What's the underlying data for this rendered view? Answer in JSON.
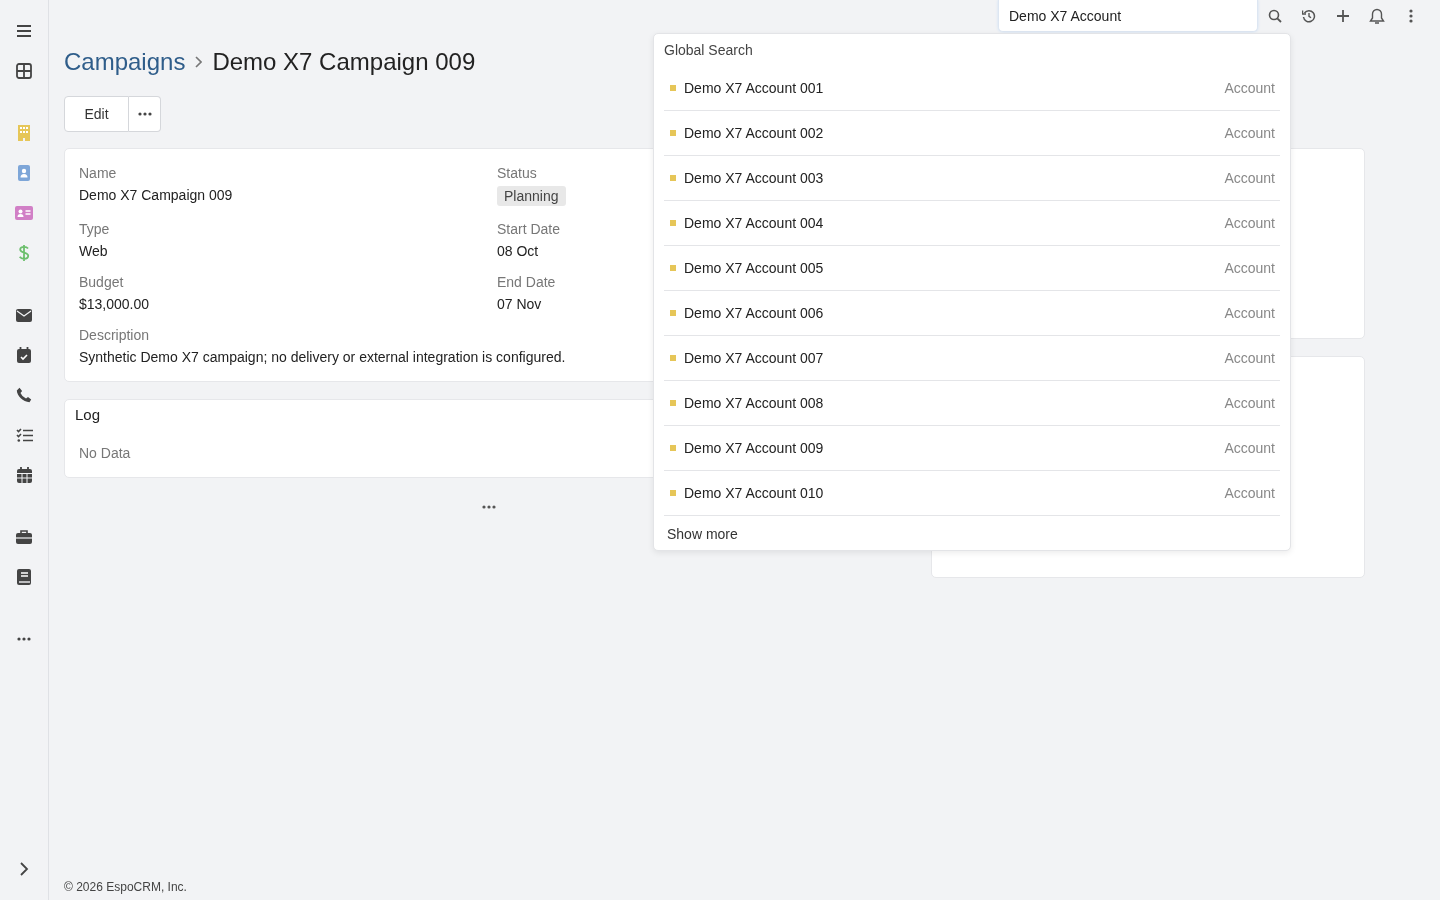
{
  "top_bar": {
    "search": {
      "value": "Demo X7 Account"
    }
  },
  "breadcrumb": {
    "parent": "Campaigns",
    "current": "Demo X7 Campaign 009"
  },
  "actions": {
    "edit": "Edit"
  },
  "fields": [
    {
      "label": "Name",
      "value": "Demo X7 Campaign 009",
      "kind": "text"
    },
    {
      "label": "Status",
      "value": "Planning",
      "kind": "badge"
    },
    {
      "label": "Type",
      "value": "Web",
      "kind": "text"
    },
    {
      "label": "Start Date",
      "value": "08 Oct",
      "kind": "text"
    },
    {
      "label": "Budget",
      "value": "$13,000.00",
      "kind": "text"
    },
    {
      "label": "End Date",
      "value": "07 Nov",
      "kind": "text"
    },
    {
      "label": "Description",
      "value": "Synthetic Demo X7 campaign; no delivery or external integration is configured.",
      "kind": "wide"
    }
  ],
  "log": {
    "title": "Log",
    "empty": "No Data"
  },
  "global_search": {
    "title": "Global Search",
    "results": [
      {
        "name": "Demo X7 Account 001",
        "type": "Account"
      },
      {
        "name": "Demo X7 Account 002",
        "type": "Account"
      },
      {
        "name": "Demo X7 Account 003",
        "type": "Account"
      },
      {
        "name": "Demo X7 Account 004",
        "type": "Account"
      },
      {
        "name": "Demo X7 Account 005",
        "type": "Account"
      },
      {
        "name": "Demo X7 Account 006",
        "type": "Account"
      },
      {
        "name": "Demo X7 Account 007",
        "type": "Account"
      },
      {
        "name": "Demo X7 Account 008",
        "type": "Account"
      },
      {
        "name": "Demo X7 Account 009",
        "type": "Account"
      },
      {
        "name": "Demo X7 Account 010",
        "type": "Account"
      }
    ],
    "more": "Show more"
  },
  "footer": "© 2026 EspoCRM, Inc."
}
